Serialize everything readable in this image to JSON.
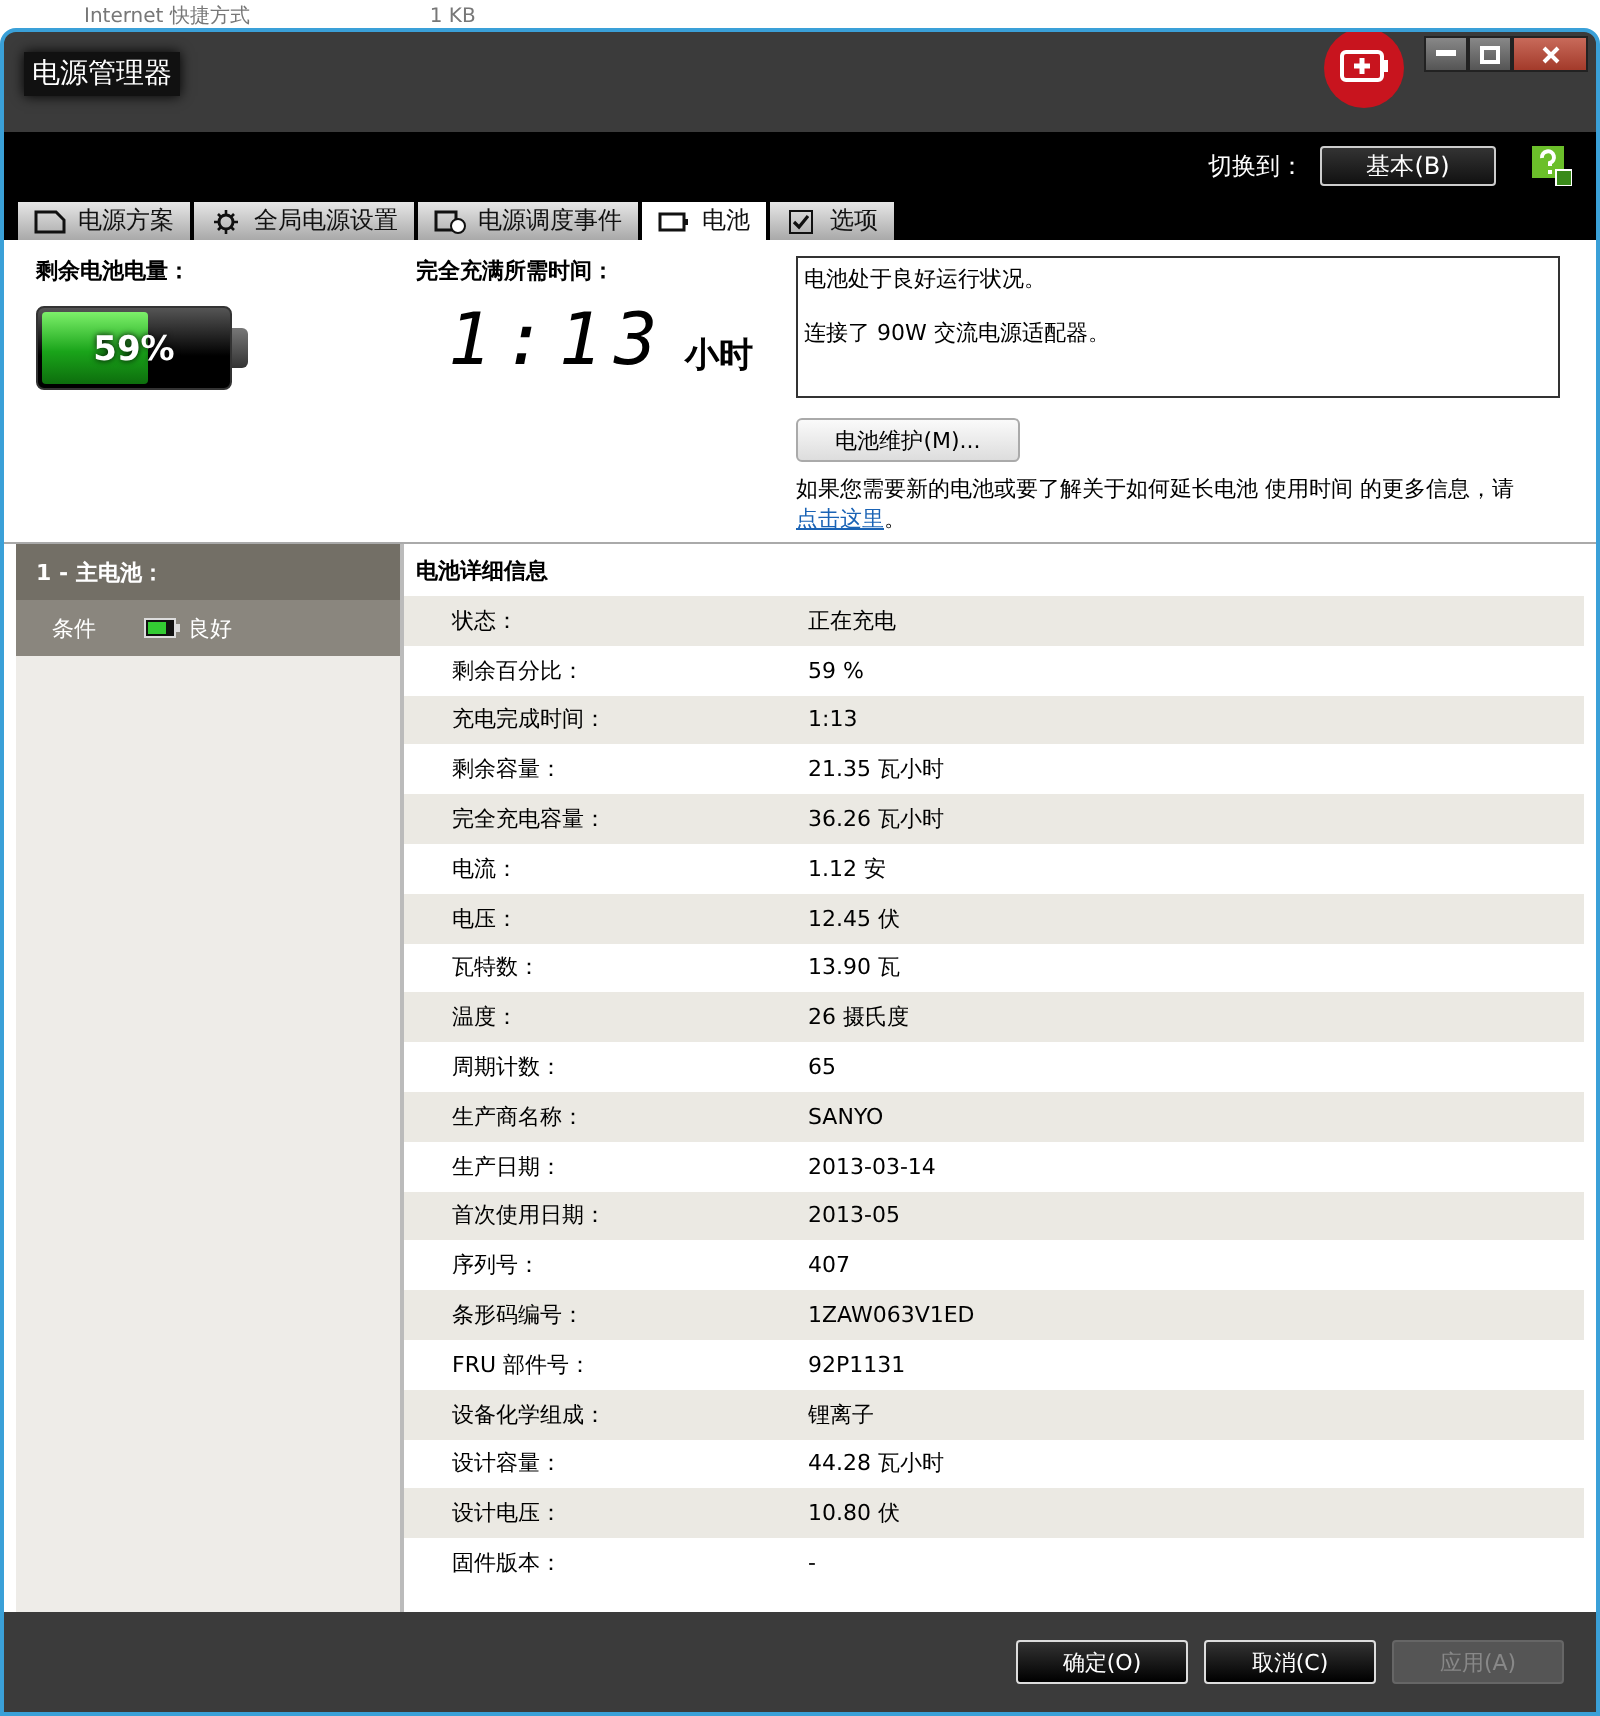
{
  "background_file": {
    "name": "Internet 快捷方式",
    "size": "1 KB"
  },
  "window": {
    "title": "电源管理器"
  },
  "toolbar": {
    "switch_label": "切换到：",
    "switch_button": "基本(B)"
  },
  "tabs": [
    {
      "label": "电源方案",
      "selected": false
    },
    {
      "label": "全局电源设置",
      "selected": false
    },
    {
      "label": "电源调度事件",
      "selected": false
    },
    {
      "label": "电池",
      "selected": true
    },
    {
      "label": "选项",
      "selected": false
    }
  ],
  "battery_summary": {
    "label": "剩余电池电量：",
    "percent": "59%",
    "level": 0.59
  },
  "charge_time": {
    "label": "完全充满所需时间：",
    "value": "1:13",
    "unit": "小时"
  },
  "status_box": [
    "电池处于良好运行状况。",
    "连接了 90W 交流电源适配器。"
  ],
  "maintenance_button": "电池维护(M)...",
  "info_text": "如果您需要新的电池或要了解关于如何延长电池 使用时间 的更多信息，请",
  "info_link": "点击这里",
  "info_end": "。",
  "battery_list": {
    "header": "1 - 主电池：",
    "condition_label": "条件",
    "condition_value": "良好"
  },
  "details": {
    "title": "电池详细信息",
    "rows": [
      {
        "label": "状态：",
        "value": "正在充电"
      },
      {
        "label": "剩余百分比：",
        "value": "59 %"
      },
      {
        "label": "充电完成时间：",
        "value": "1:13"
      },
      {
        "label": "剩余容量：",
        "value": "21.35 瓦小时"
      },
      {
        "label": "完全充电容量：",
        "value": "36.26 瓦小时"
      },
      {
        "label": "电流：",
        "value": "1.12 安"
      },
      {
        "label": "电压：",
        "value": "12.45 伏"
      },
      {
        "label": "瓦特数：",
        "value": "13.90 瓦"
      },
      {
        "label": "温度：",
        "value": "26 摄氏度"
      },
      {
        "label": "周期计数：",
        "value": "65"
      },
      {
        "label": "生产商名称：",
        "value": "SANYO"
      },
      {
        "label": "生产日期：",
        "value": "2013-03-14"
      },
      {
        "label": "首次使用日期：",
        "value": "2013-05"
      },
      {
        "label": "序列号：",
        "value": "407"
      },
      {
        "label": "条形码编号：",
        "value": "1ZAW063V1ED"
      },
      {
        "label": "FRU 部件号：",
        "value": "92P1131"
      },
      {
        "label": "设备化学组成：",
        "value": "锂离子"
      },
      {
        "label": "设计容量：",
        "value": "44.28 瓦小时"
      },
      {
        "label": "设计电压：",
        "value": "10.80 伏"
      },
      {
        "label": "固件版本：",
        "value": "-"
      }
    ]
  },
  "buttons": [
    {
      "label": "确定(O)",
      "disabled": false
    },
    {
      "label": "取消(C)",
      "disabled": false
    },
    {
      "label": "应用(A)",
      "disabled": true
    }
  ]
}
